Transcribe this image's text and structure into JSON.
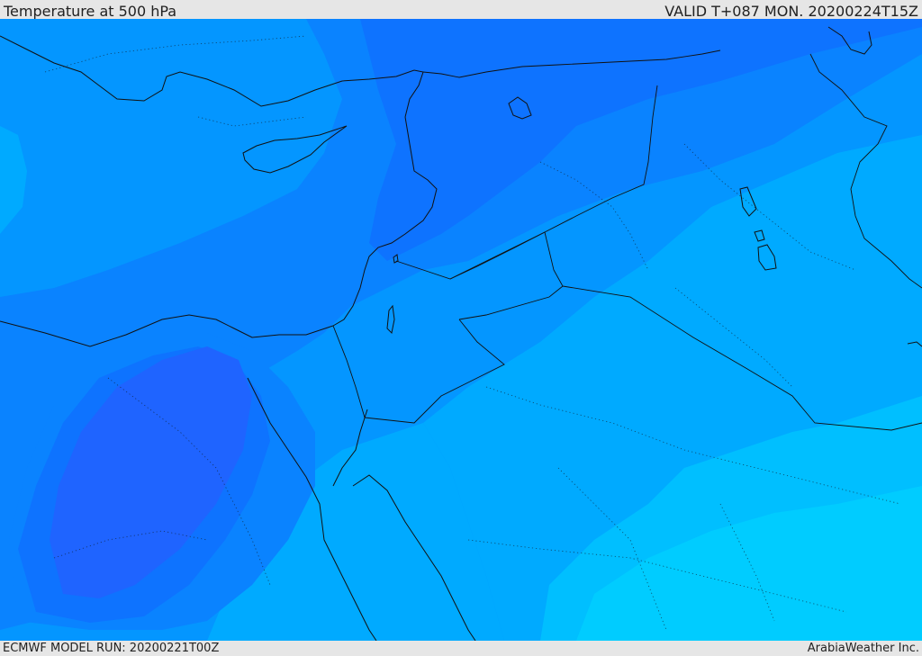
{
  "header": {
    "title": "Temperature at 500 hPa",
    "valid": "VALID T+087 MON. 20200224T15Z"
  },
  "footer": {
    "model_run": "ECMWF MODEL RUN: 20200221T00Z",
    "credit": "ArabiaWeather Inc."
  },
  "map": {
    "region": "Eastern Mediterranean / Levant / Arabian Peninsula",
    "temperature_bands": [
      {
        "name": "coldest-band",
        "color": "#1f64ff"
      },
      {
        "name": "very-cold-band",
        "color": "#0e73ff"
      },
      {
        "name": "cold-band",
        "color": "#0a83ff"
      },
      {
        "name": "cool-band",
        "color": "#0496ff"
      },
      {
        "name": "mild-band",
        "color": "#00aaff"
      },
      {
        "name": "warm-band",
        "color": "#00bfff"
      },
      {
        "name": "warmest-band",
        "color": "#00ccff"
      }
    ]
  }
}
